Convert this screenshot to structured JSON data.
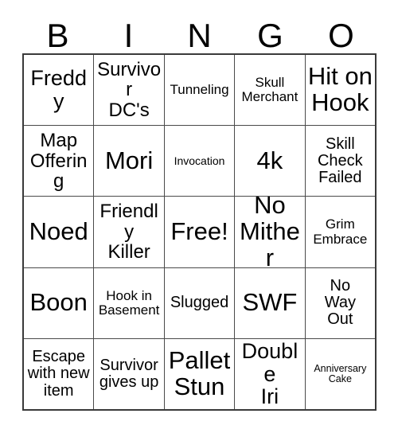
{
  "card": {
    "header_letters": [
      "B",
      "I",
      "N",
      "G",
      "O"
    ],
    "rows": [
      [
        {
          "text": "Freddy",
          "size": "xl"
        },
        {
          "text": "Survivor\nDC's",
          "size": "lg"
        },
        {
          "text": "Tunneling",
          "size": "sm"
        },
        {
          "text": "Skull\nMerchant",
          "size": "sm"
        },
        {
          "text": "Hit on\nHook",
          "size": "xxl"
        }
      ],
      [
        {
          "text": "Map\nOffering",
          "size": "lg"
        },
        {
          "text": "Mori",
          "size": "xxl"
        },
        {
          "text": "Invocation",
          "size": "xs"
        },
        {
          "text": "4k",
          "size": "xxl"
        },
        {
          "text": "Skill\nCheck\nFailed",
          "size": "md"
        }
      ],
      [
        {
          "text": "Noed",
          "size": "xxl"
        },
        {
          "text": "Friendly\nKiller",
          "size": "lg"
        },
        {
          "text": "Free!",
          "size": "xxl"
        },
        {
          "text": "No\nMither",
          "size": "xxl"
        },
        {
          "text": "Grim\nEmbrace",
          "size": "sm"
        }
      ],
      [
        {
          "text": "Boon",
          "size": "xxl"
        },
        {
          "text": "Hook in\nBasement",
          "size": "sm"
        },
        {
          "text": "Slugged",
          "size": "md"
        },
        {
          "text": "SWF",
          "size": "xxl"
        },
        {
          "text": "No\nWay\nOut",
          "size": "md"
        }
      ],
      [
        {
          "text": "Escape\nwith new\nitem",
          "size": "md"
        },
        {
          "text": "Survivor\ngives up",
          "size": "md"
        },
        {
          "text": "Pallet\nStun",
          "size": "xxl"
        },
        {
          "text": "Double\nIri",
          "size": "xl"
        },
        {
          "text": "Anniversary\nCake",
          "size": "xxs"
        }
      ]
    ],
    "free_space": {
      "row": 2,
      "col": 2,
      "label": "Free!"
    },
    "colors": {
      "background": "#ffffff",
      "text": "#000000",
      "grid_line": "#4a4a4a",
      "outer_border": "#3a3a3a"
    }
  }
}
